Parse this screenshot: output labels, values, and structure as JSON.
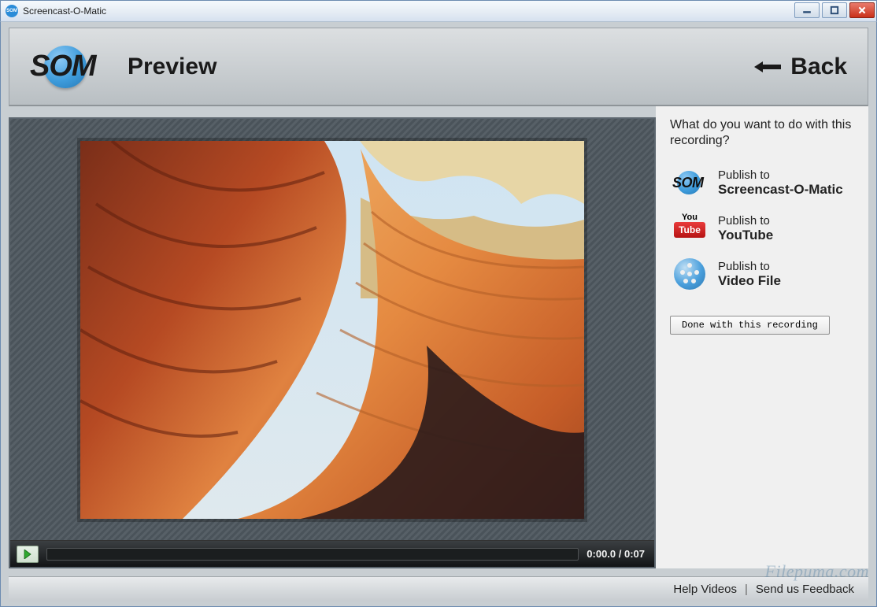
{
  "window": {
    "title": "Screencast-O-Matic"
  },
  "header": {
    "logo_text": "SOM",
    "page_title": "Preview",
    "back_label": "Back"
  },
  "player": {
    "current_time": "0:00.0",
    "total_time": "0:07",
    "time_display": "0:00.0 / 0:07",
    "progress_pct": 0
  },
  "side": {
    "question": "What do you want to do with this recording?",
    "options": [
      {
        "icon": "som",
        "line1": "Publish to",
        "line2": "Screencast-O-Matic"
      },
      {
        "icon": "youtube",
        "line1": "Publish to",
        "line2": "YouTube"
      },
      {
        "icon": "file",
        "line1": "Publish to",
        "line2": "Video File"
      }
    ],
    "done_label": "Done with this recording"
  },
  "footer": {
    "help_label": "Help Videos",
    "feedback_label": "Send us Feedback"
  },
  "watermark": "Filepuma.com",
  "icons": {
    "minimize": "minimize-icon",
    "maximize": "maximize-icon",
    "close": "close-icon",
    "back_arrow": "arrow-left-icon",
    "play": "play-icon",
    "youtube_you": "You",
    "youtube_tube": "Tube"
  }
}
